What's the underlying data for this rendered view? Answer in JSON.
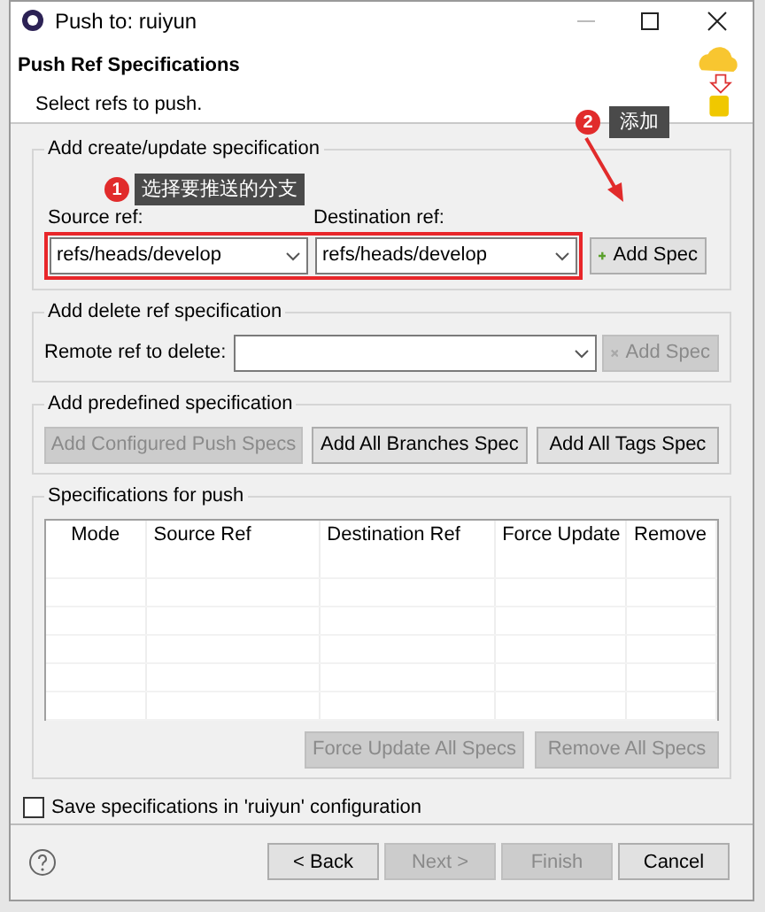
{
  "window": {
    "title": "Push to: ruiyun"
  },
  "header": {
    "title": "Push Ref Specifications",
    "description": "Select refs to push."
  },
  "create_group": {
    "label": "Add create/update specification",
    "source_label": "Source ref:",
    "source_value": "refs/heads/develop",
    "destination_label": "Destination ref:",
    "destination_value": "refs/heads/develop",
    "button": {
      "label": "Add Spec",
      "disabled": false
    }
  },
  "delete_group": {
    "label": "Add delete ref specification",
    "remote_label": "Remote ref to delete:",
    "button": {
      "label": "Add Spec",
      "disabled": true
    }
  },
  "predefined_group": {
    "label": "Add predefined specification",
    "buttons": [
      {
        "label": "Add Configured Push Specs",
        "disabled": true
      },
      {
        "label": "Add All Branches Spec",
        "disabled": false
      },
      {
        "label": "Add All Tags Spec",
        "disabled": false
      }
    ]
  },
  "specs_group": {
    "label": "Specifications for push",
    "table": {
      "columns": [
        "Mode",
        "Source Ref",
        "Destination Ref",
        "Force Update",
        "Remove"
      ]
    },
    "buttons": [
      {
        "label": "Force Update All Specs",
        "disabled": true
      },
      {
        "label": "Remove All Specs",
        "disabled": true
      }
    ]
  },
  "save_option": {
    "label": "Save specifications in 'ruiyun' configuration",
    "checked": false
  },
  "footer": {
    "buttons": [
      {
        "label": "< Back",
        "disabled": false
      },
      {
        "label": "Next >",
        "disabled": true
      },
      {
        "label": "Finish",
        "disabled": true
      },
      {
        "label": "Cancel",
        "disabled": false
      }
    ]
  },
  "annotations": [
    {
      "number": "1",
      "text": "选择要推送的分支"
    },
    {
      "number": "2",
      "text": "添加"
    }
  ]
}
